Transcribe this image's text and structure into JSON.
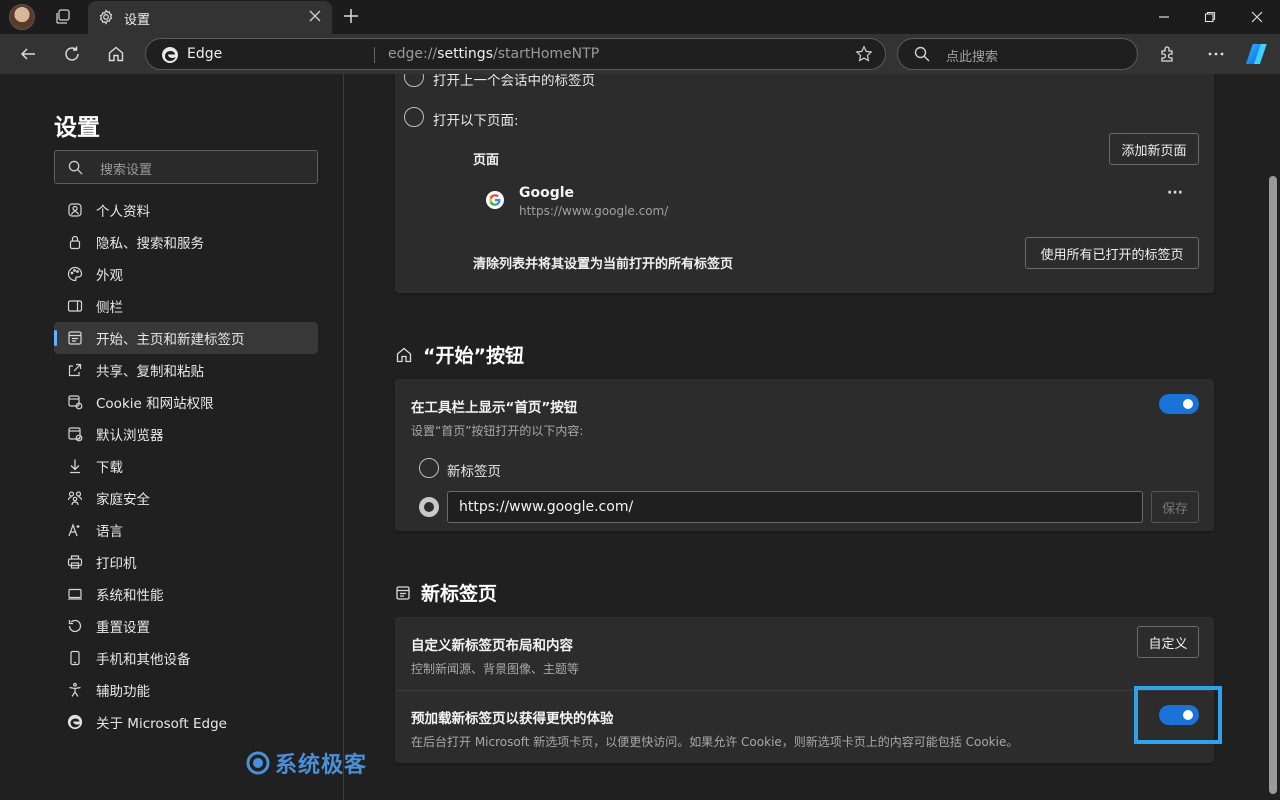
{
  "titlebar": {
    "tab_title": "设置"
  },
  "toolbar": {
    "site_label": "Edge",
    "url_prefix": "edge://",
    "url_host": "settings",
    "url_path": "/startHomeNTP",
    "search_placeholder": "点此搜索"
  },
  "sidebar": {
    "title": "设置",
    "search_placeholder": "搜索设置",
    "items": [
      {
        "label": "个人资料",
        "icon": "profile-icon"
      },
      {
        "label": "隐私、搜索和服务",
        "icon": "lock-icon"
      },
      {
        "label": "外观",
        "icon": "palette-icon"
      },
      {
        "label": "侧栏",
        "icon": "sidebar-icon"
      },
      {
        "label": "开始、主页和新建标签页",
        "icon": "home-tabs-icon",
        "active": true
      },
      {
        "label": "共享、复制和粘贴",
        "icon": "share-icon"
      },
      {
        "label": "Cookie 和网站权限",
        "icon": "cookie-permissions-icon"
      },
      {
        "label": "默认浏览器",
        "icon": "default-browser-icon"
      },
      {
        "label": "下载",
        "icon": "download-icon"
      },
      {
        "label": "家庭安全",
        "icon": "family-icon"
      },
      {
        "label": "语言",
        "icon": "language-icon"
      },
      {
        "label": "打印机",
        "icon": "printer-icon"
      },
      {
        "label": "系统和性能",
        "icon": "system-icon"
      },
      {
        "label": "重置设置",
        "icon": "reset-icon"
      },
      {
        "label": "手机和其他设备",
        "icon": "phone-icon"
      },
      {
        "label": "辅助功能",
        "icon": "accessibility-icon"
      },
      {
        "label": "关于 Microsoft Edge",
        "icon": "edge-logo-icon"
      }
    ]
  },
  "startup": {
    "option_prev_session": "打开上一个会话中的标签页",
    "option_open_pages": "打开以下页面:",
    "pages_label": "页面",
    "add_page_button": "添加新页面",
    "page_entry": {
      "title": "Google",
      "url": "https://www.google.com/"
    },
    "more_label": "···",
    "clear_label": "清除列表并将其设置为当前打开的所有标签页",
    "use_open_tabs_button": "使用所有已打开的标签页"
  },
  "home_button": {
    "section_title": "“开始”按钮",
    "show_label": "在工具栏上显示“首页”按钮",
    "sub_label": "设置“首页”按钮打开的以下内容:",
    "option_new_tab": "新标签页",
    "url_value": "https://www.google.com/",
    "save_button": "保存",
    "toggle_on": true
  },
  "new_tab": {
    "section_title": "新标签页",
    "customize_label": "自定义新标签页布局和内容",
    "customize_desc": "控制新闻源、背景图像、主题等",
    "customize_button": "自定义",
    "preload_label": "预加载新标签页以获得更快的体验",
    "preload_desc": "在后台打开 Microsoft 新选项卡页，以便更快访问。如果允许 Cookie，则新选项卡页上的内容可能包括 Cookie。",
    "preload_toggle_on": true
  },
  "watermark": {
    "text": "系统极客"
  },
  "colors": {
    "accent": "#1a73d8",
    "active_indicator": "#60b4ff",
    "highlight": "#2ea2ea"
  }
}
